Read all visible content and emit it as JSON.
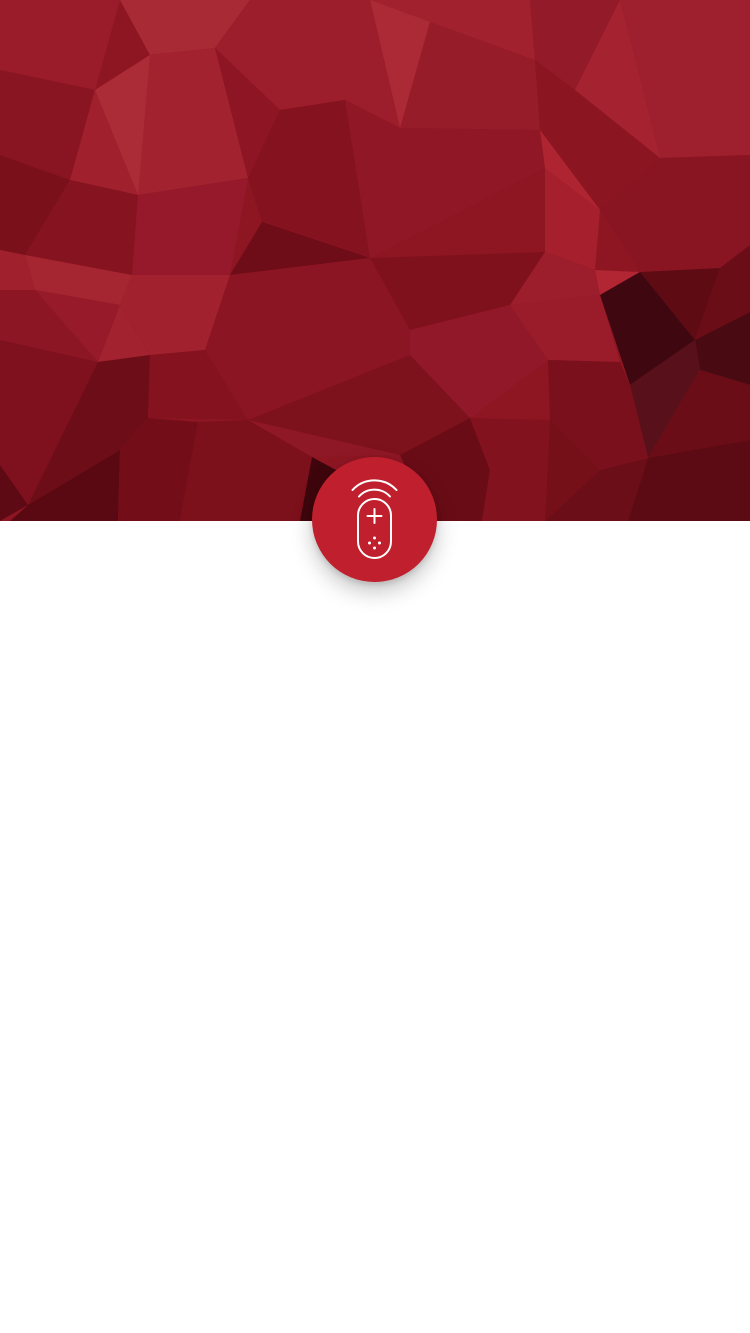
{
  "theme": {
    "brand_red": "#c0202e",
    "hero_base": "#8e1623",
    "background": "#ffffff",
    "icon_stroke": "#ffffff"
  },
  "hero": {
    "style": "low-poly red geometric pattern"
  },
  "app_badge": {
    "icon": "remote-control-icon"
  }
}
